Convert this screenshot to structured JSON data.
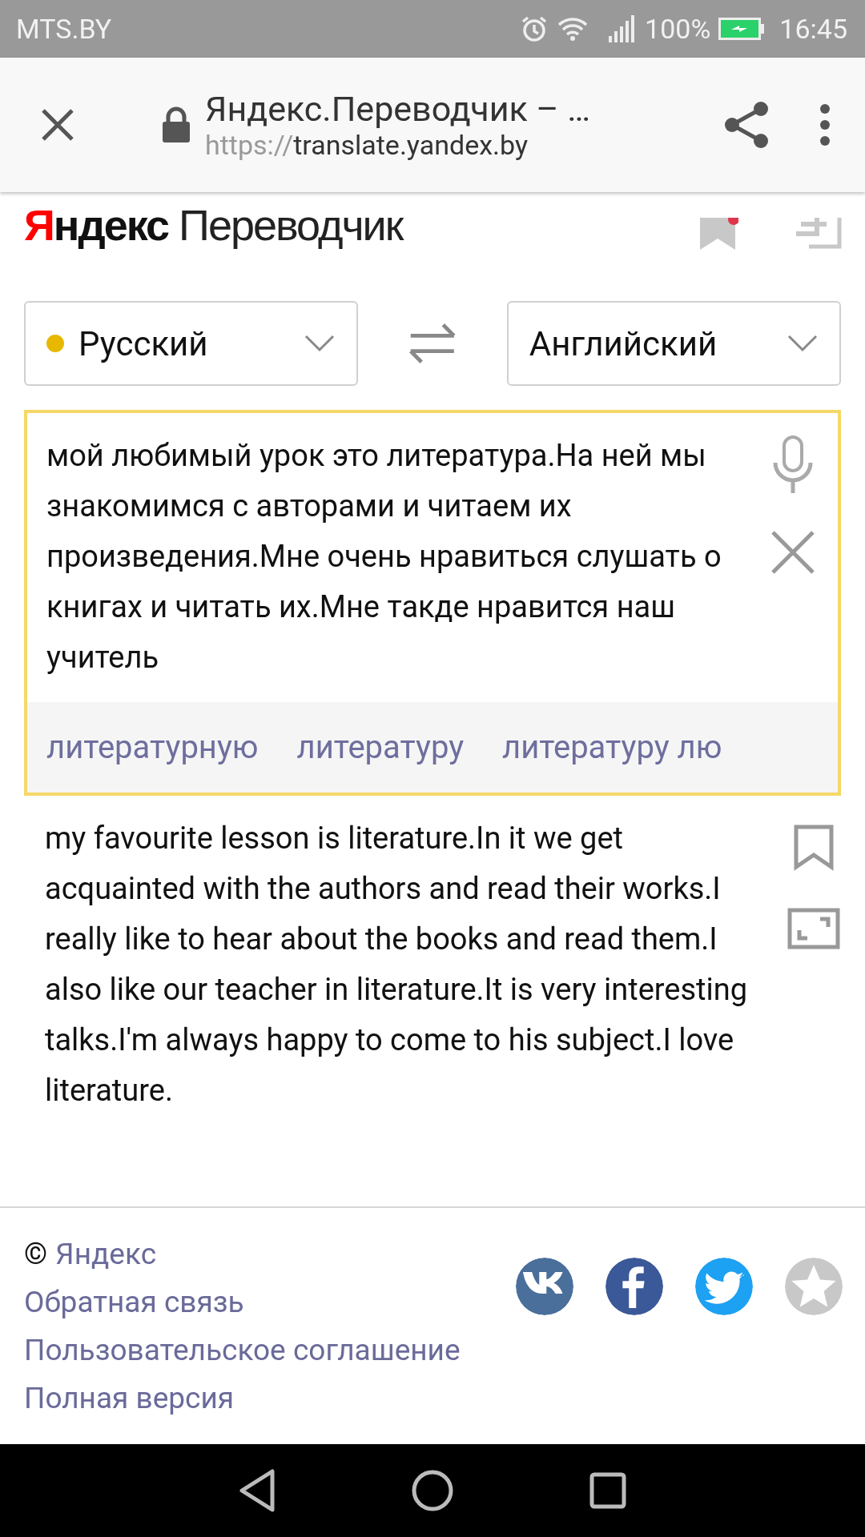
{
  "status_bar": {
    "carrier": "MTS.BY",
    "battery": "100%",
    "time": "16:45"
  },
  "browser_bar": {
    "title": "Яндекс.Переводчик – …",
    "url_scheme": "https://",
    "url_host": "translate.yandex.by"
  },
  "logo": {
    "brand": "Яндекс",
    "product": "Переводчик"
  },
  "languages": {
    "source": {
      "label": "Русский",
      "color": "#e8b800"
    },
    "target": {
      "label": "Английский"
    }
  },
  "input": {
    "value": "мой любимый урок это литература.На ней мы знакомимся с авторами и читаем их произведения.Мне очень нравиться слушать о книгах и читать их.Мне такде нравится наш учитель",
    "suggestions": [
      "литературную",
      "литературу",
      "литературу лю"
    ]
  },
  "output": {
    "text": "my favourite lesson is literature.In it we get acquainted with the authors and read their works.I really like to hear about the books and read them.I also like our teacher in literature.It is very interesting talks.I'm always happy to come to his subject.I love literature."
  },
  "footer": {
    "copyright": "©",
    "links": [
      "Яндекс",
      "Обратная связь",
      "Пользовательское соглашение",
      "Полная версия"
    ],
    "social": [
      {
        "kind": "vk",
        "color": "#4a6f9a"
      },
      {
        "kind": "facebook",
        "color": "#3b5998"
      },
      {
        "kind": "twitter",
        "color": "#1da1f2"
      },
      {
        "kind": "favorite",
        "color": "#c8c8c8"
      }
    ]
  }
}
